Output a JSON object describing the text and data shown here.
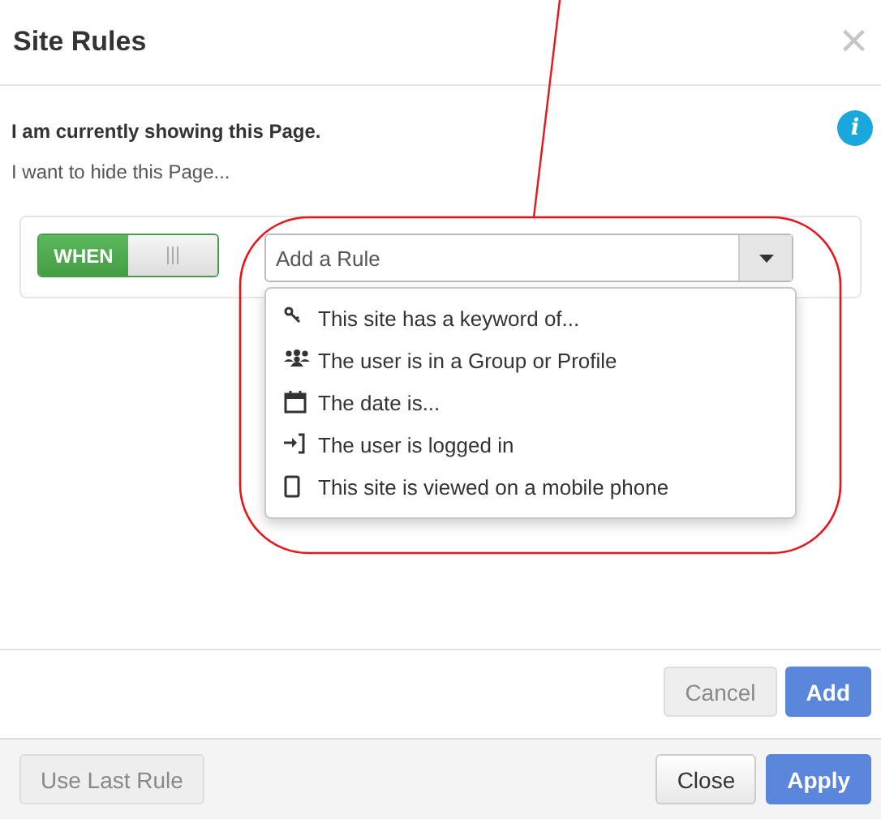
{
  "dialog": {
    "title": "Site Rules",
    "close": "×"
  },
  "intro": {
    "heading": "I am currently showing this Page.",
    "text": "I want to hide this Page...",
    "info": "i"
  },
  "rule": {
    "toggle": {
      "label": "WHEN",
      "on": true
    },
    "select": {
      "placeholder": "Add a Rule",
      "expanded": true
    },
    "options": [
      {
        "kind": "keyword",
        "label": "This site has a keyword of..."
      },
      {
        "kind": "group",
        "label": "The user is in a Group or Profile"
      },
      {
        "kind": "date",
        "label": "The date is..."
      },
      {
        "kind": "login",
        "label": "The user is logged in"
      },
      {
        "kind": "mobile",
        "label": "This site is viewed on a mobile phone"
      }
    ]
  },
  "rule_actions": [
    {
      "label": "Cancel",
      "kind": "default",
      "disabled": true
    },
    {
      "label": "Add",
      "kind": "primary",
      "disabled": false
    }
  ],
  "footer": {
    "left": [
      {
        "label": "Use Last Rule",
        "kind": "default",
        "disabled": true
      }
    ],
    "right": [
      {
        "label": "Close",
        "kind": "default",
        "disabled": false
      },
      {
        "label": "Apply",
        "kind": "primary",
        "disabled": false
      }
    ]
  }
}
